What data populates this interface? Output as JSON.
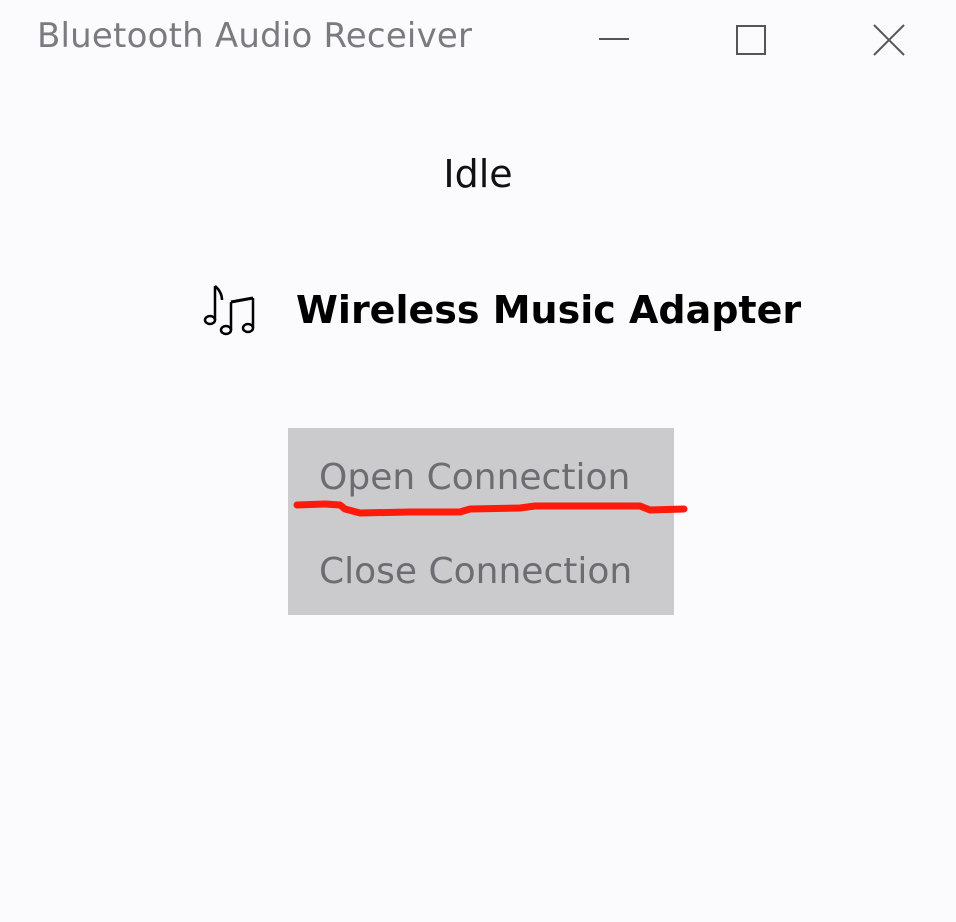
{
  "window": {
    "title": "Bluetooth Audio Receiver",
    "controls": {
      "minimize_icon": "minimize-icon",
      "maximize_icon": "maximize-icon",
      "close_icon": "close-icon"
    }
  },
  "status": {
    "text": "Idle"
  },
  "device": {
    "icon": "music-notes-icon",
    "name": "Wireless Music Adapter"
  },
  "menu": {
    "items": [
      {
        "label": "Open Connection"
      },
      {
        "label": "Close Connection"
      }
    ]
  },
  "annotation": {
    "color": "#ff1a0a"
  },
  "colors": {
    "background": "#fbfafd",
    "menu_background": "#cbcacd",
    "menu_text": "#6c6c72",
    "title_text": "#7a7a80"
  }
}
